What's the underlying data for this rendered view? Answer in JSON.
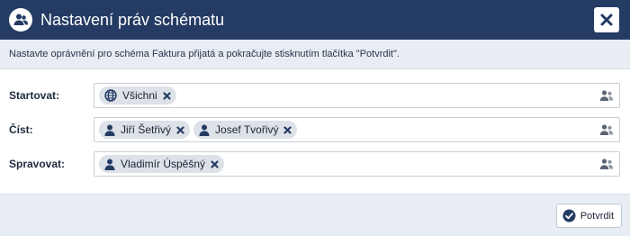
{
  "dialog": {
    "title": "Nastavení práv schématu",
    "header_icon": "users-circle-icon",
    "close_icon": "close-icon",
    "info_text": "Nastavte oprávnění pro schéma Faktura přijatá a pokračujte stisknutím tlačítka \"Potvrdit\".",
    "confirm_label": "Potvrdit",
    "confirm_icon": "check-circle-icon"
  },
  "permissions": [
    {
      "label": "Startovat:",
      "entries": [
        {
          "name": "Všichni",
          "icon": "globe-icon"
        }
      ]
    },
    {
      "label": "Číst:",
      "entries": [
        {
          "name": "Jiří Šetřivý",
          "icon": "user-icon"
        },
        {
          "name": "Josef Tvořivý",
          "icon": "user-icon"
        }
      ]
    },
    {
      "label": "Spravovat:",
      "entries": [
        {
          "name": "Vladimír Úspěšný",
          "icon": "user-icon"
        }
      ]
    }
  ],
  "colors": {
    "header": "#243b63",
    "info_bar": "#e8ecf3",
    "chip": "#dde1e8"
  }
}
